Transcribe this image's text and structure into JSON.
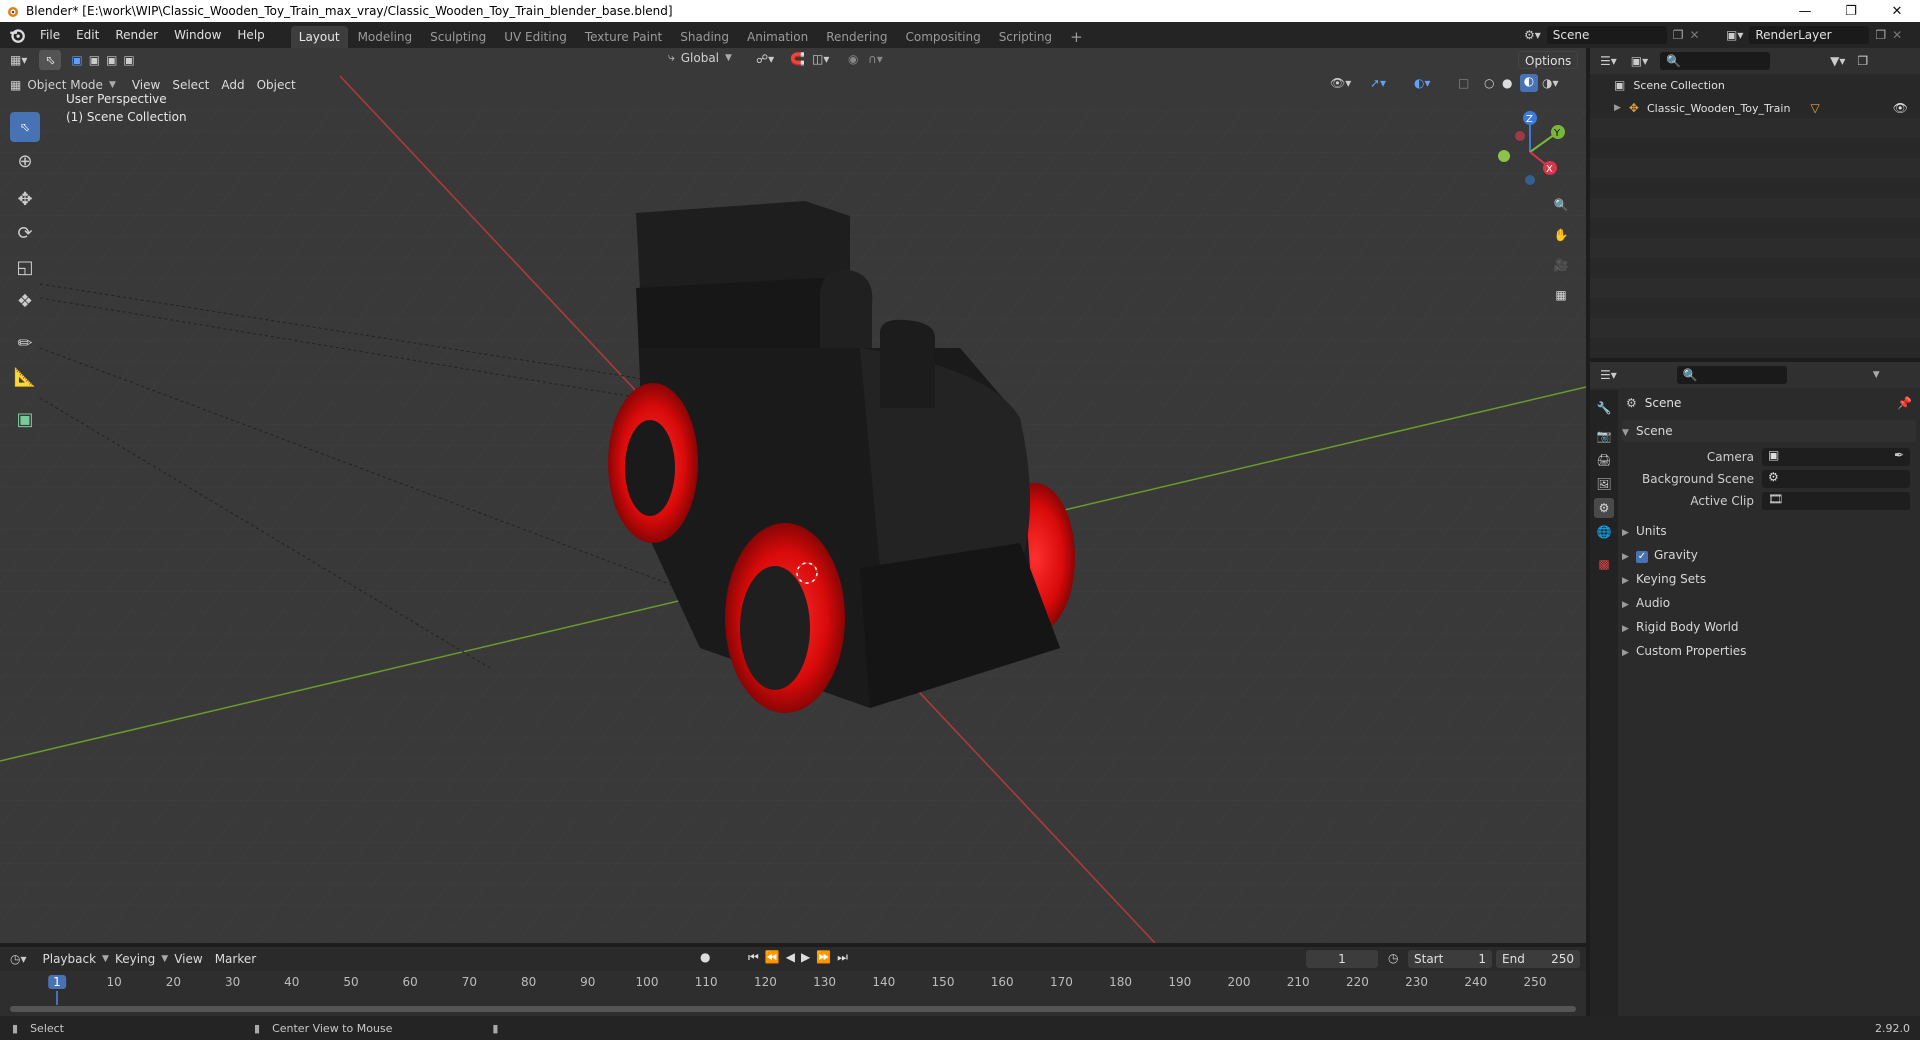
{
  "window": {
    "title": "Blender* [E:\\work\\WIP\\Classic_Wooden_Toy_Train_max_vray/Classic_Wooden_Toy_Train_blender_base.blend]"
  },
  "menu": {
    "file": "File",
    "edit": "Edit",
    "render": "Render",
    "window": "Window",
    "help": "Help"
  },
  "workspaces": [
    "Layout",
    "Modeling",
    "Sculpting",
    "UV Editing",
    "Texture Paint",
    "Shading",
    "Animation",
    "Rendering",
    "Compositing",
    "Scripting"
  ],
  "scene_selector": {
    "scene": "Scene",
    "view_layer": "RenderLayer"
  },
  "viewport": {
    "mode": "Object Mode",
    "menus": [
      "View",
      "Select",
      "Add",
      "Object"
    ],
    "transform_orientation": "Global",
    "options_label": "Options",
    "overlay_text_1": "User Perspective",
    "overlay_text_2": "(1) Scene Collection",
    "gizmo_axes": {
      "x": "X",
      "y": "Y",
      "z": "Z"
    }
  },
  "outliner": {
    "root": "Scene Collection",
    "items": [
      {
        "label": "Classic_Wooden_Toy_Train"
      }
    ]
  },
  "properties": {
    "context_label": "Scene",
    "panel_title": "Scene",
    "fields": [
      {
        "label": "Camera",
        "value": ""
      },
      {
        "label": "Background Scene",
        "value": ""
      },
      {
        "label": "Active Clip",
        "value": ""
      }
    ],
    "subpanels": [
      "Units",
      "Gravity",
      "Keying Sets",
      "Audio",
      "Rigid Body World",
      "Custom Properties"
    ],
    "gravity_checked": true
  },
  "timeline": {
    "menus": [
      "Playback",
      "Keying",
      "View",
      "Marker"
    ],
    "current_frame": "1",
    "start_label": "Start",
    "start_value": "1",
    "end_label": "End",
    "end_value": "250",
    "ticks": [
      "1",
      "10",
      "20",
      "30",
      "40",
      "50",
      "60",
      "70",
      "80",
      "90",
      "100",
      "110",
      "120",
      "130",
      "140",
      "150",
      "160",
      "170",
      "180",
      "190",
      "200",
      "210",
      "220",
      "230",
      "240",
      "250"
    ]
  },
  "statusbar": {
    "left": "Select",
    "middle": "Center View to Mouse",
    "version": "2.92.0"
  },
  "colors": {
    "accent": "#4772b3",
    "axis_x": "#c0392b",
    "axis_y": "#6a9a2a",
    "wheel_red": "#e01010",
    "train_body": "#1b1b1b"
  }
}
